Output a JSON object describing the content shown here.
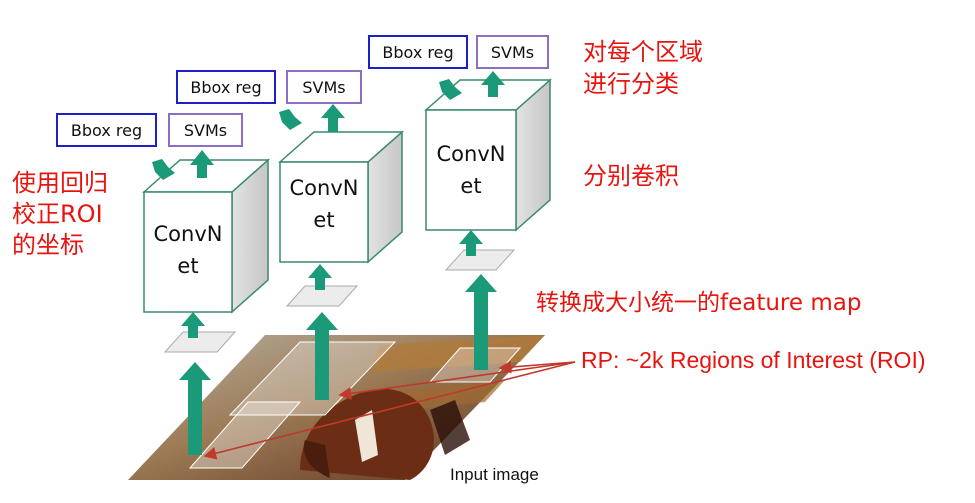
{
  "colors": {
    "arrow": "#1a9a78",
    "cube_edge": "#3a8a6a",
    "bbox_border": "#1f1fc8",
    "svm_border": "#8a6fc2",
    "annotation_red": "#e8140f",
    "pointer_line": "#c0392b"
  },
  "annotations": {
    "left_line1": "使用回归",
    "left_line2": "校正ROI",
    "left_line3": "的坐标",
    "top_right_line1": "对每个区域",
    "top_right_line2": "进行分类",
    "conv_each": "分别卷积",
    "warp": "转换成大小统一的feature map",
    "rp": "RP: ~2k Regions of Interest (ROI)",
    "input": "Input image"
  },
  "networks": [
    {
      "line1": "ConvN",
      "line2": "et",
      "bbox": "Bbox reg",
      "svm": "SVMs"
    },
    {
      "line1": "ConvN",
      "line2": "et",
      "bbox": "Bbox reg",
      "svm": "SVMs"
    },
    {
      "line1": "ConvN",
      "line2": "et",
      "bbox": "Bbox reg",
      "svm": "SVMs"
    }
  ]
}
